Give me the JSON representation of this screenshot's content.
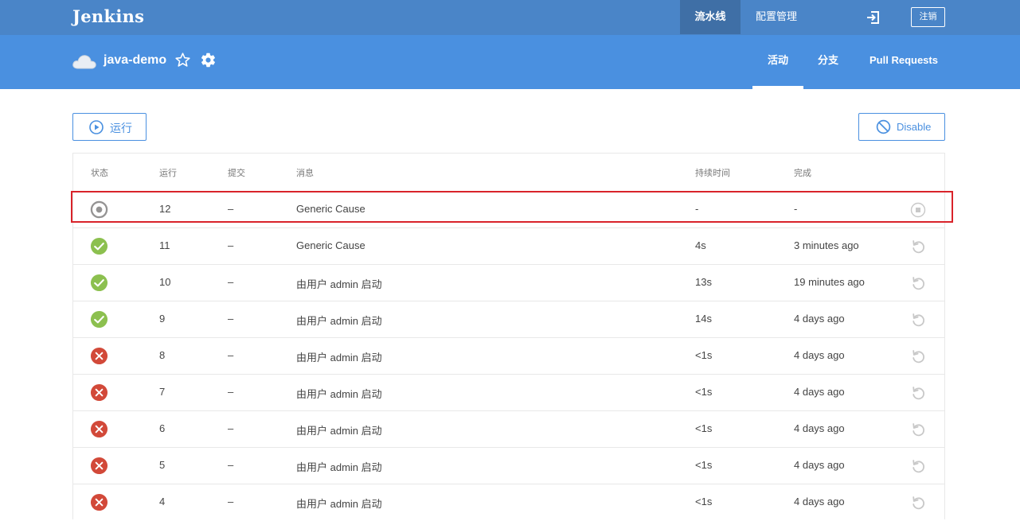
{
  "header": {
    "logo": "Jenkins",
    "nav_pipelines": "流水线",
    "nav_admin": "配置管理",
    "logout": "注销"
  },
  "pipeline": {
    "name": "java-demo",
    "tabs": [
      "活动",
      "分支",
      "Pull Requests"
    ]
  },
  "toolbar": {
    "run_label": "运行",
    "disable_label": "Disable"
  },
  "table": {
    "headers": [
      "状态",
      "运行",
      "提交",
      "消息",
      "持续时间",
      "完成"
    ],
    "rows": [
      {
        "status": "running",
        "run": "12",
        "commit": "–",
        "message": "Generic Cause",
        "duration": "-",
        "completed": "-",
        "action": "stop"
      },
      {
        "status": "success",
        "run": "11",
        "commit": "–",
        "message": "Generic Cause",
        "duration": "4s",
        "completed": "3 minutes ago",
        "action": "replay"
      },
      {
        "status": "success",
        "run": "10",
        "commit": "–",
        "message": "由用户 admin 启动",
        "duration": "13s",
        "completed": "19 minutes ago",
        "action": "replay"
      },
      {
        "status": "success",
        "run": "9",
        "commit": "–",
        "message": "由用户 admin 启动",
        "duration": "14s",
        "completed": "4 days ago",
        "action": "replay"
      },
      {
        "status": "failure",
        "run": "8",
        "commit": "–",
        "message": "由用户 admin 启动",
        "duration": "<1s",
        "completed": "4 days ago",
        "action": "replay"
      },
      {
        "status": "failure",
        "run": "7",
        "commit": "–",
        "message": "由用户 admin 启动",
        "duration": "<1s",
        "completed": "4 days ago",
        "action": "replay"
      },
      {
        "status": "failure",
        "run": "6",
        "commit": "–",
        "message": "由用户 admin 启动",
        "duration": "<1s",
        "completed": "4 days ago",
        "action": "replay"
      },
      {
        "status": "failure",
        "run": "5",
        "commit": "–",
        "message": "由用户 admin 启动",
        "duration": "<1s",
        "completed": "4 days ago",
        "action": "replay"
      },
      {
        "status": "failure",
        "run": "4",
        "commit": "–",
        "message": "由用户 admin 启动",
        "duration": "<1s",
        "completed": "4 days ago",
        "action": "replay"
      }
    ]
  },
  "colors": {
    "topbar": "#4a85c8",
    "subbar": "#4a90e0",
    "success": "#8cc04f",
    "failure": "#d24939",
    "running": "#949393",
    "highlight": "#d9232a"
  }
}
